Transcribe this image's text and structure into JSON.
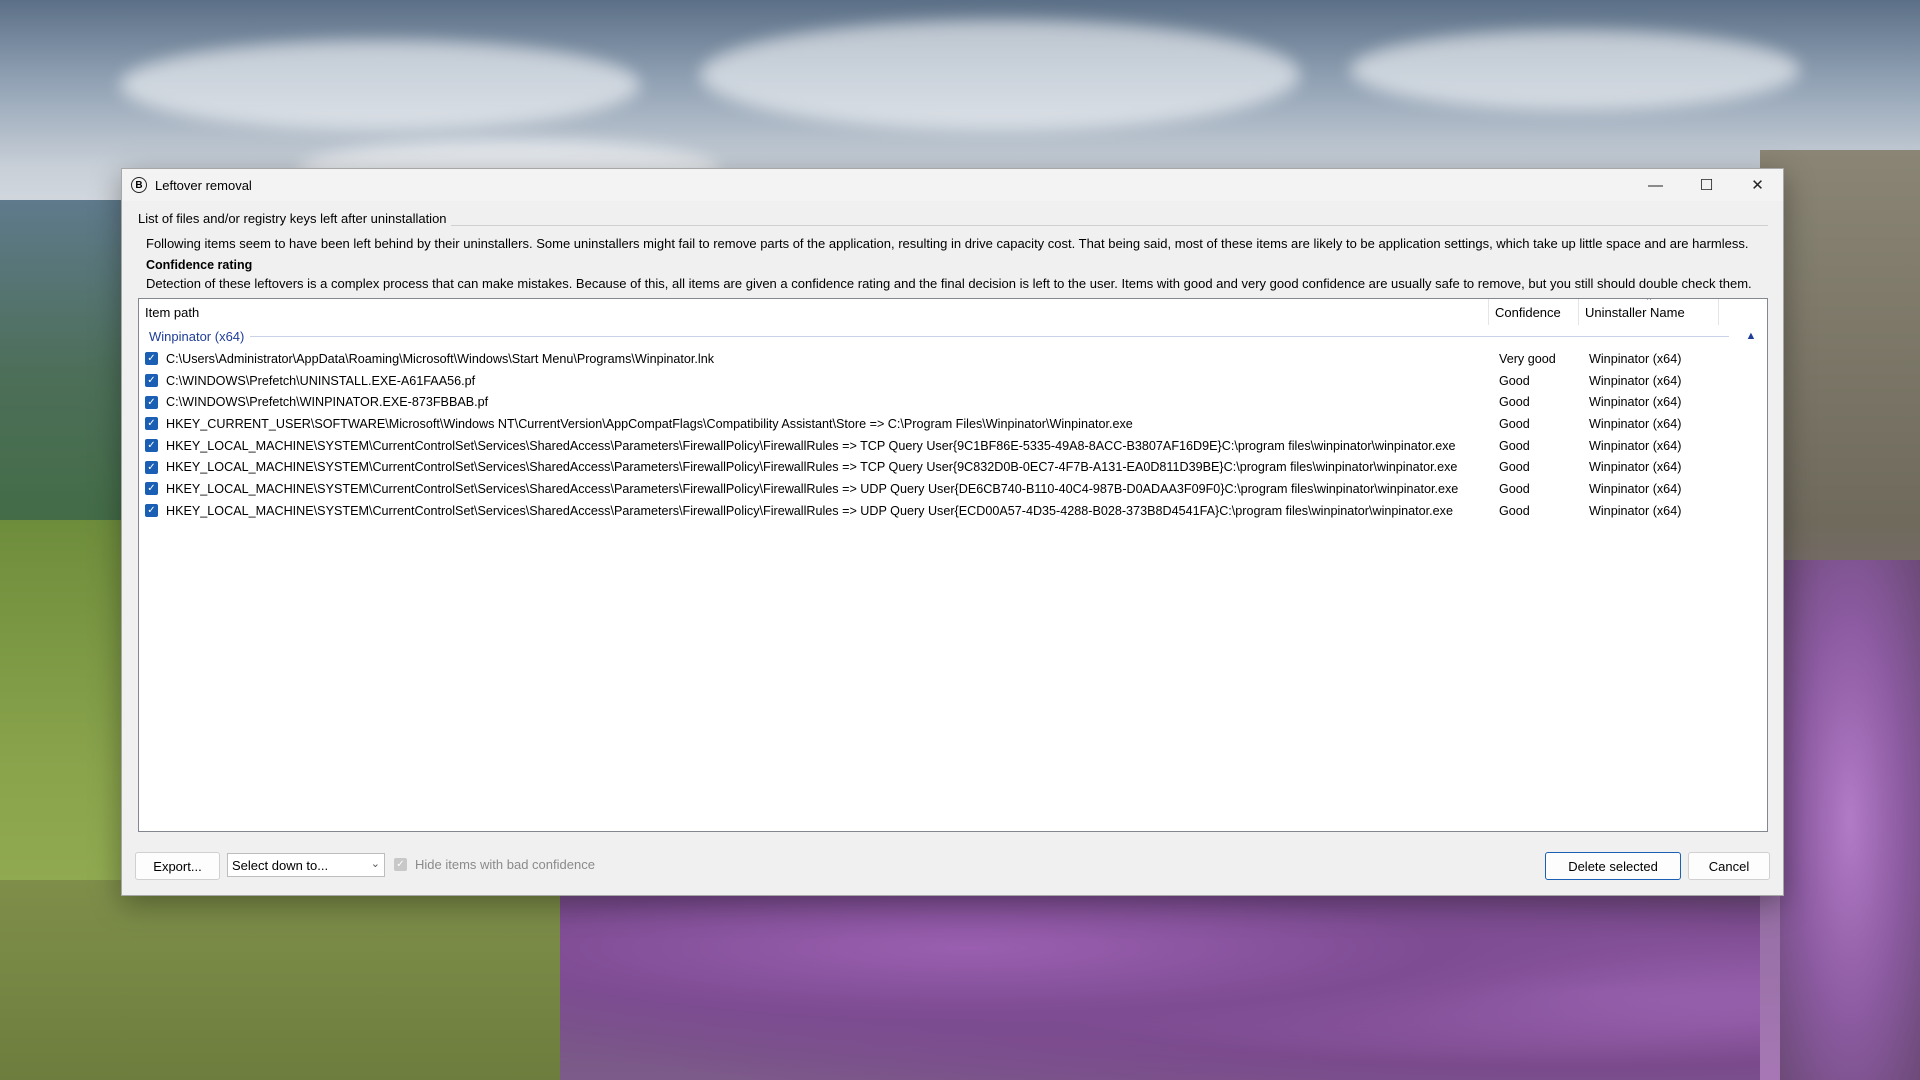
{
  "window": {
    "title": "Leftover removal",
    "app_icon_letter": "B",
    "minimize_glyph": "—",
    "maximize_glyph": "☐",
    "close_glyph": "✕"
  },
  "group_title": "List of files and/or registry keys left after uninstallation",
  "description": "Following items seem to have been left behind by their uninstallers. Some uninstallers might fail to remove parts of the application, resulting in drive capacity cost. That being said, most of these items are likely to be application settings, which take up little space and are harmless.",
  "confidence": {
    "heading": "Confidence rating",
    "text": "Detection of these leftovers is a complex process that can make mistakes. Because of this, all items are given a confidence rating and the final decision is left to the user. Items with good and very good confidence are usually safe to remove, but you still should double check them."
  },
  "list": {
    "columns": [
      "Item path",
      "Confidence",
      "Uninstaller Name"
    ],
    "group": "Winpinator (x64)",
    "rows": [
      {
        "path": "C:\\Users\\Administrator\\AppData\\Roaming\\Microsoft\\Windows\\Start Menu\\Programs\\Winpinator.lnk",
        "confidence": "Very good",
        "uninstaller": "Winpinator (x64)"
      },
      {
        "path": "C:\\WINDOWS\\Prefetch\\UNINSTALL.EXE-A61FAA56.pf",
        "confidence": "Good",
        "uninstaller": "Winpinator (x64)"
      },
      {
        "path": "C:\\WINDOWS\\Prefetch\\WINPINATOR.EXE-873FBBAB.pf",
        "confidence": "Good",
        "uninstaller": "Winpinator (x64)"
      },
      {
        "path": "HKEY_CURRENT_USER\\SOFTWARE\\Microsoft\\Windows NT\\CurrentVersion\\AppCompatFlags\\Compatibility Assistant\\Store => C:\\Program Files\\Winpinator\\Winpinator.exe",
        "confidence": "Good",
        "uninstaller": "Winpinator (x64)"
      },
      {
        "path": "HKEY_LOCAL_MACHINE\\SYSTEM\\CurrentControlSet\\Services\\SharedAccess\\Parameters\\FirewallPolicy\\FirewallRules => TCP Query User{9C1BF86E-5335-49A8-8ACC-B3807AF16D9E}C:\\program files\\winpinator\\winpinator.exe",
        "confidence": "Good",
        "uninstaller": "Winpinator (x64)"
      },
      {
        "path": "HKEY_LOCAL_MACHINE\\SYSTEM\\CurrentControlSet\\Services\\SharedAccess\\Parameters\\FirewallPolicy\\FirewallRules => TCP Query User{9C832D0B-0EC7-4F7B-A131-EA0D811D39BE}C:\\program files\\winpinator\\winpinator.exe",
        "confidence": "Good",
        "uninstaller": "Winpinator (x64)"
      },
      {
        "path": "HKEY_LOCAL_MACHINE\\SYSTEM\\CurrentControlSet\\Services\\SharedAccess\\Parameters\\FirewallPolicy\\FirewallRules => UDP Query User{DE6CB740-B110-40C4-987B-D0ADAA3F09F0}C:\\program files\\winpinator\\winpinator.exe",
        "confidence": "Good",
        "uninstaller": "Winpinator (x64)"
      },
      {
        "path": "HKEY_LOCAL_MACHINE\\SYSTEM\\CurrentControlSet\\Services\\SharedAccess\\Parameters\\FirewallPolicy\\FirewallRules => UDP Query User{ECD00A57-4D35-4288-B028-373B8D4541FA}C:\\program files\\winpinator\\winpinator.exe",
        "confidence": "Good",
        "uninstaller": "Winpinator (x64)"
      }
    ]
  },
  "bottom": {
    "export_label": "Export...",
    "select_value": "Select down to...",
    "hide_label": "Hide items with bad confidence",
    "delete_label": "Delete selected",
    "cancel_label": "Cancel"
  },
  "colors": {
    "accent": "#1a5fb4",
    "group_text": "#1f3d99"
  },
  "icons": {
    "checkbox": "checkmark-icon",
    "collapse": "chevron-up-icon",
    "dropdown": "chevron-down-icon"
  }
}
